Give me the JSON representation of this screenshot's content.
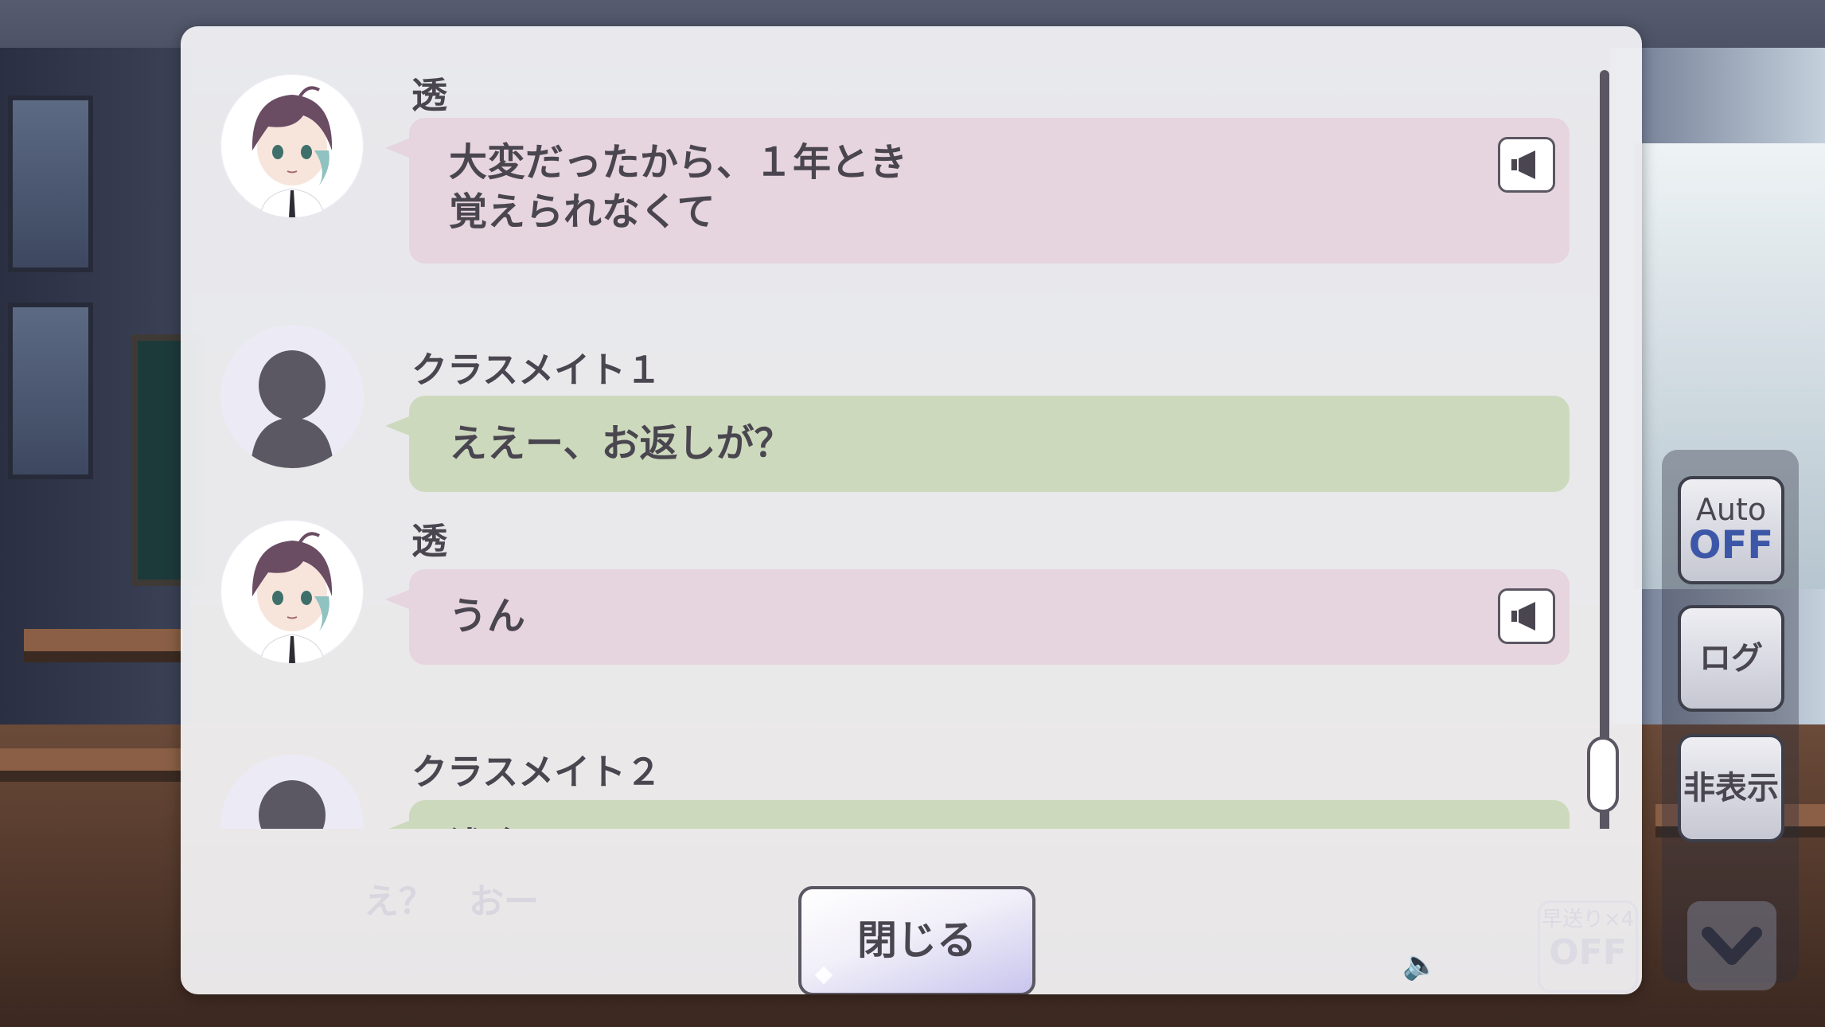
{
  "dialog_log": {
    "entries": [
      {
        "speaker": "透",
        "text": "大変だったから、１年とき\n覚えられなくて",
        "color": "#e6d4de",
        "voice": true,
        "avatar": "character-toru-avatar"
      },
      {
        "speaker": "クラスメイト１",
        "text": "ええー、お返しが？",
        "color": "#cdd9bd",
        "voice": false,
        "avatar": "silhouette-avatar"
      },
      {
        "speaker": "透",
        "text": "うん",
        "color": "#e6d4de",
        "voice": true,
        "avatar": "character-toru-avatar"
      },
      {
        "speaker": "クラスメイト２",
        "text": "浅倉っちー",
        "color": "#cdd9bd",
        "voice": false,
        "avatar": "silhouette-avatar"
      }
    ],
    "close_label": "閉じる",
    "voice_icon": "speaker-icon"
  },
  "background_dialog": {
    "text": "え？　おー",
    "fast_forward_label": "早送り×4",
    "fast_forward_state": "OFF"
  },
  "side_controls": {
    "auto_label": "Auto",
    "auto_state": "OFF",
    "log_label": "ログ",
    "hide_label": "非表示",
    "down_icon": "chevron-down-icon"
  }
}
